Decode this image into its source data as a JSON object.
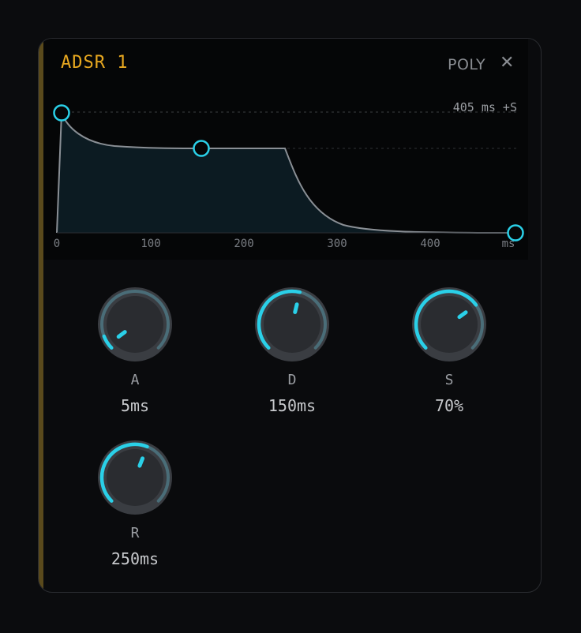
{
  "envelope": {
    "title": "ADSR 1",
    "mode": "POLY",
    "close_glyph": "✕",
    "total_time_label": "405 ms +S",
    "time_axis": {
      "ticks": [
        "0",
        "100",
        "200",
        "300",
        "400"
      ],
      "unit": "ms"
    },
    "accent_color": "#e8a820",
    "curve_color": "#2ad0e8"
  },
  "knobs": [
    {
      "label": "A",
      "value": "5ms",
      "fraction": 0.03
    },
    {
      "label": "D",
      "value": "150ms",
      "fraction": 0.55
    },
    {
      "label": "S",
      "value": "70%",
      "fraction": 0.7
    },
    {
      "label": "R",
      "value": "250ms",
      "fraction": 0.58
    }
  ]
}
